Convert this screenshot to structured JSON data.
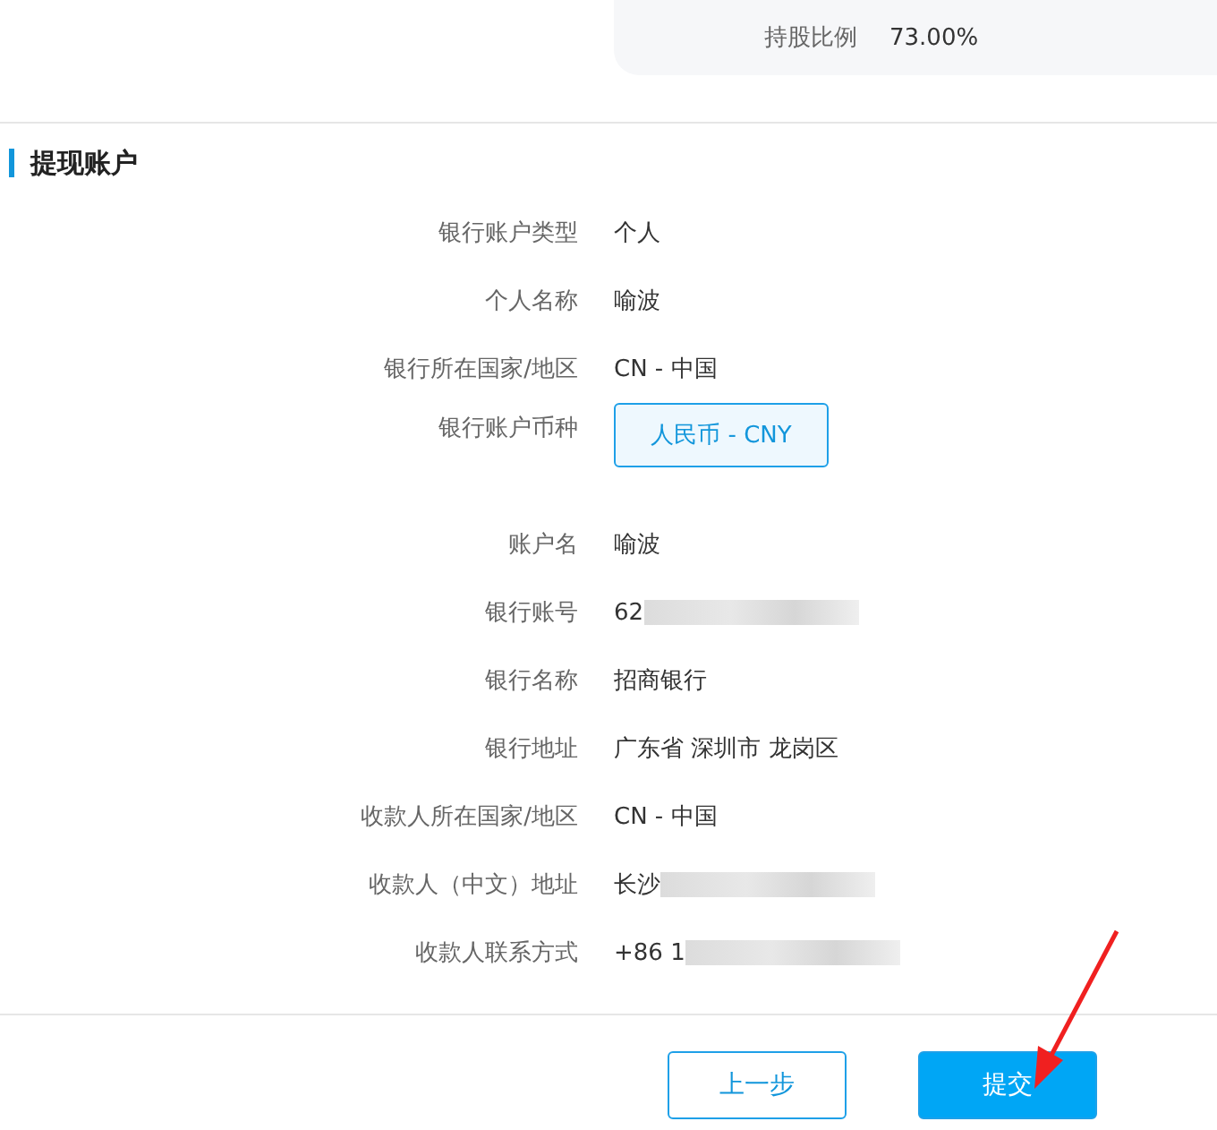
{
  "summary": {
    "label": "持股比例",
    "value": "73.00%"
  },
  "section": {
    "title": "提现账户"
  },
  "fields": [
    {
      "label": "银行账户类型",
      "kind": "text",
      "value": "个人",
      "redacted": false
    },
    {
      "label": "个人名称",
      "kind": "text",
      "value": "喻波",
      "redacted": false
    },
    {
      "label": "银行所在国家/地区",
      "kind": "text",
      "value": "CN - 中国",
      "redacted": false
    },
    {
      "label": "银行账户币种",
      "kind": "option",
      "value": "人民币 - CNY",
      "redacted": false
    },
    {
      "label": "账户名",
      "kind": "text",
      "value": "喻波",
      "redacted": false
    },
    {
      "label": "银行账号",
      "kind": "text",
      "value": "62",
      "redacted": true
    },
    {
      "label": "银行名称",
      "kind": "text",
      "value": "招商银行",
      "redacted": false
    },
    {
      "label": "银行地址",
      "kind": "text",
      "value": "广东省 深圳市 龙岗区",
      "redacted": false
    },
    {
      "label": "收款人所在国家/地区",
      "kind": "text",
      "value": "CN - 中国",
      "redacted": false
    },
    {
      "label": "收款人（中文）地址",
      "kind": "text",
      "value": "长沙",
      "redacted": true
    },
    {
      "label": "收款人联系方式",
      "kind": "text",
      "value": "+86 1",
      "redacted": true
    }
  ],
  "buttons": [
    {
      "label": "上一步",
      "kind": "secondary"
    },
    {
      "label": "提交",
      "kind": "primary"
    }
  ]
}
